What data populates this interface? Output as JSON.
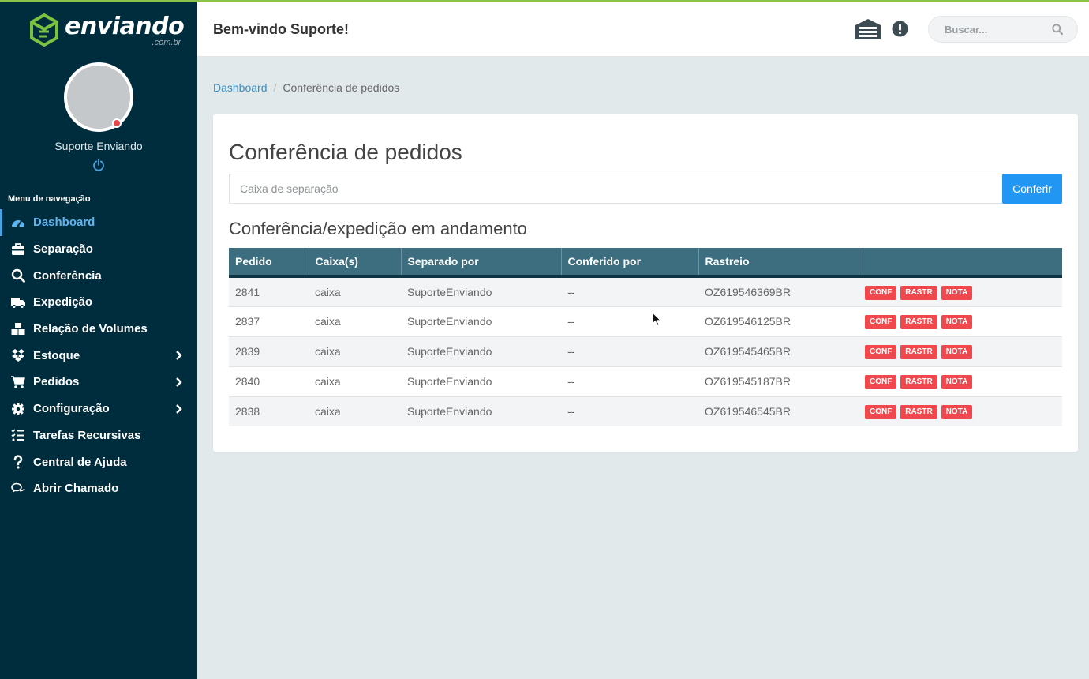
{
  "sidebar": {
    "logo_name": "enviando",
    "logo_sub": ".com.br",
    "user_name": "Suporte Enviando",
    "menu_title": "Menu de navegação",
    "items": [
      {
        "label": "Dashboard",
        "icon": "dashboard-icon",
        "active": true
      },
      {
        "label": "Separação",
        "icon": "toolbox-icon"
      },
      {
        "label": "Conferência",
        "icon": "search-icon"
      },
      {
        "label": "Expedição",
        "icon": "truck-icon"
      },
      {
        "label": "Relação de Volumes",
        "icon": "boxes-icon"
      },
      {
        "label": "Estoque",
        "icon": "dropbox-icon",
        "submenu": true
      },
      {
        "label": "Pedidos",
        "icon": "cart-icon",
        "submenu": true
      },
      {
        "label": "Configuração",
        "icon": "gear-icon",
        "submenu": true
      },
      {
        "label": "Tarefas Recursivas",
        "icon": "tasks-icon"
      },
      {
        "label": "Central de Ajuda",
        "icon": "question-icon"
      },
      {
        "label": "Abrir Chamado",
        "icon": "chat-icon"
      }
    ]
  },
  "header": {
    "welcome": "Bem-vindo Suporte!",
    "search_placeholder": "Buscar..."
  },
  "breadcrumb": {
    "home": "Dashboard",
    "current": "Conferência de pedidos"
  },
  "main": {
    "title": "Conferência de pedidos",
    "input_placeholder": "Caixa de separação",
    "button_label": "Conferir",
    "subtitle": "Conferência/expedição em andamento",
    "table": {
      "headers": [
        "Pedido",
        "Caixa(s)",
        "Separado por",
        "Conferido por",
        "Rastreio",
        ""
      ],
      "action_labels": [
        "CONF",
        "RASTR",
        "NOTA"
      ],
      "rows": [
        [
          "2841",
          "caixa",
          "SuporteEnviando",
          "--",
          "OZ619546369BR"
        ],
        [
          "2837",
          "caixa",
          "SuporteEnviando",
          "--",
          "OZ619546125BR"
        ],
        [
          "2839",
          "caixa",
          "SuporteEnviando",
          "--",
          "OZ619545465BR"
        ],
        [
          "2840",
          "caixa",
          "SuporteEnviando",
          "--",
          "OZ619545187BR"
        ],
        [
          "2838",
          "caixa",
          "SuporteEnviando",
          "--",
          "OZ619546545BR"
        ]
      ]
    }
  },
  "colors": {
    "sidebar_bg": "#002d3d",
    "accent_green": "#8bc34a",
    "primary_blue": "#2196f3",
    "table_header": "#3c6e7f",
    "tag_red": "#f0484d"
  }
}
